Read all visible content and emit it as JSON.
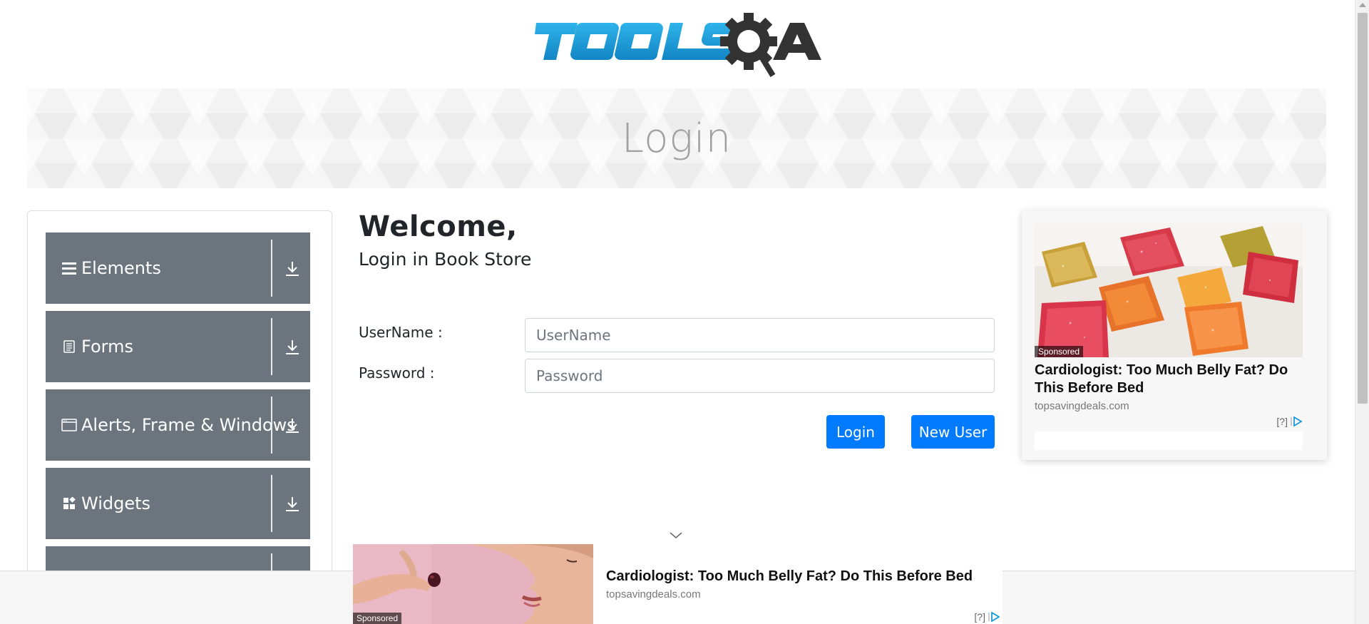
{
  "logo": {
    "brand": "TOOLSQA"
  },
  "banner": {
    "title": "Login"
  },
  "sidebar": {
    "groups": [
      {
        "label": "Elements",
        "icon": "hamburger-icon"
      },
      {
        "label": "Forms",
        "icon": "document-icon"
      },
      {
        "label": "Alerts, Frame & Windows",
        "icon": "window-icon"
      },
      {
        "label": "Widgets",
        "icon": "widgets-icon"
      },
      {
        "label": "",
        "icon": ""
      }
    ]
  },
  "main": {
    "heading": "Welcome,",
    "subheading": "Login in Book Store",
    "username_label": "UserName :",
    "username_placeholder": "UserName",
    "password_label": "Password :",
    "password_placeholder": "Password",
    "login_button": "Login",
    "new_user_button": "New User"
  },
  "ad_right": {
    "sponsored": "Sponsored",
    "title": "Cardiologist: Too Much Belly Fat? Do This Before Bed",
    "source": "topsavingdeals.com",
    "info": "[?]"
  },
  "ad_bottom": {
    "sponsored": "Sponsored",
    "title": "Cardiologist: Too Much Belly Fat? Do This Before Bed",
    "source": "topsavingdeals.com",
    "info": "[?]"
  },
  "colors": {
    "primary": "#007bff",
    "menu_gray": "#6c757d",
    "logo_blue": "#1a9bd7",
    "logo_dark": "#333333"
  }
}
